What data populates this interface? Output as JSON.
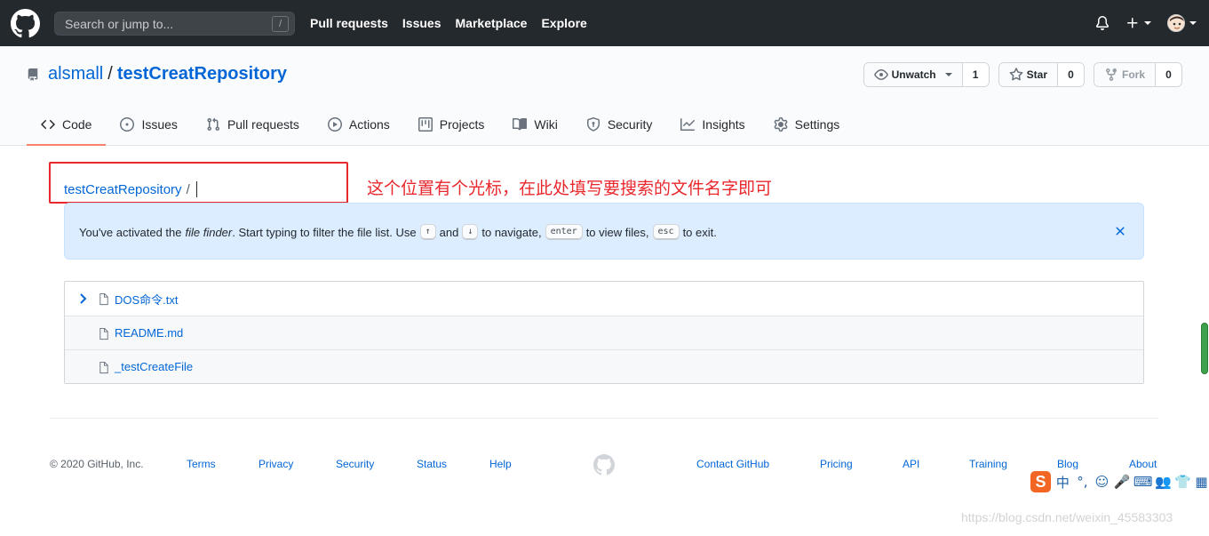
{
  "header": {
    "search_placeholder": "Search or jump to...",
    "search_key": "/",
    "nav": [
      "Pull requests",
      "Issues",
      "Marketplace",
      "Explore"
    ],
    "bell_icon": "bell-icon",
    "plus_icon": "plus-icon"
  },
  "repo": {
    "owner": "alsmall",
    "separator": "/",
    "name": "testCreatRepository",
    "watch": {
      "label": "Unwatch",
      "count": "1"
    },
    "star": {
      "label": "Star",
      "count": "0"
    },
    "fork": {
      "label": "Fork",
      "count": "0"
    }
  },
  "tabs": [
    {
      "label": "Code",
      "icon": "code-icon",
      "active": true
    },
    {
      "label": "Issues",
      "icon": "issue-icon"
    },
    {
      "label": "Pull requests",
      "icon": "pull-request-icon"
    },
    {
      "label": "Actions",
      "icon": "play-icon"
    },
    {
      "label": "Projects",
      "icon": "project-icon"
    },
    {
      "label": "Wiki",
      "icon": "book-icon"
    },
    {
      "label": "Security",
      "icon": "shield-icon"
    },
    {
      "label": "Insights",
      "icon": "graph-icon"
    },
    {
      "label": "Settings",
      "icon": "gear-icon"
    }
  ],
  "finder": {
    "breadcrumb_repo": "testCreatRepository",
    "breadcrumb_sep": "/",
    "annotation": "这个位置有个光标，在此处填写要搜索的文件名字即可"
  },
  "flash": {
    "t1": "You've activated the",
    "t2": "file finder",
    "t3": ". Start typing to filter the file list. Use",
    "k1": "↑",
    "t4": "and",
    "k2": "↓",
    "t5": "to navigate,",
    "k3": "enter",
    "t6": "to view files,",
    "k4": "esc",
    "t7": "to exit."
  },
  "files": [
    "DOS命令.txt",
    "README.md",
    "_testCreateFile"
  ],
  "footer": {
    "copyright": "© 2020 GitHub, Inc.",
    "links": [
      "Terms",
      "Privacy",
      "Security",
      "Status",
      "Help",
      "Contact GitHub",
      "Pricing",
      "API",
      "Training",
      "Blog",
      "About"
    ]
  },
  "ime": [
    "S",
    "中",
    "°,",
    "☺",
    "🎤",
    "⌨",
    "👥",
    "👕",
    "▦"
  ],
  "watermark": "https://blog.csdn.net/weixin_45583303",
  "colors": {
    "accent_red": "#e8282d",
    "link": "#0366d6",
    "header_bg": "#24292e",
    "tab_underline": "#f9826c"
  }
}
